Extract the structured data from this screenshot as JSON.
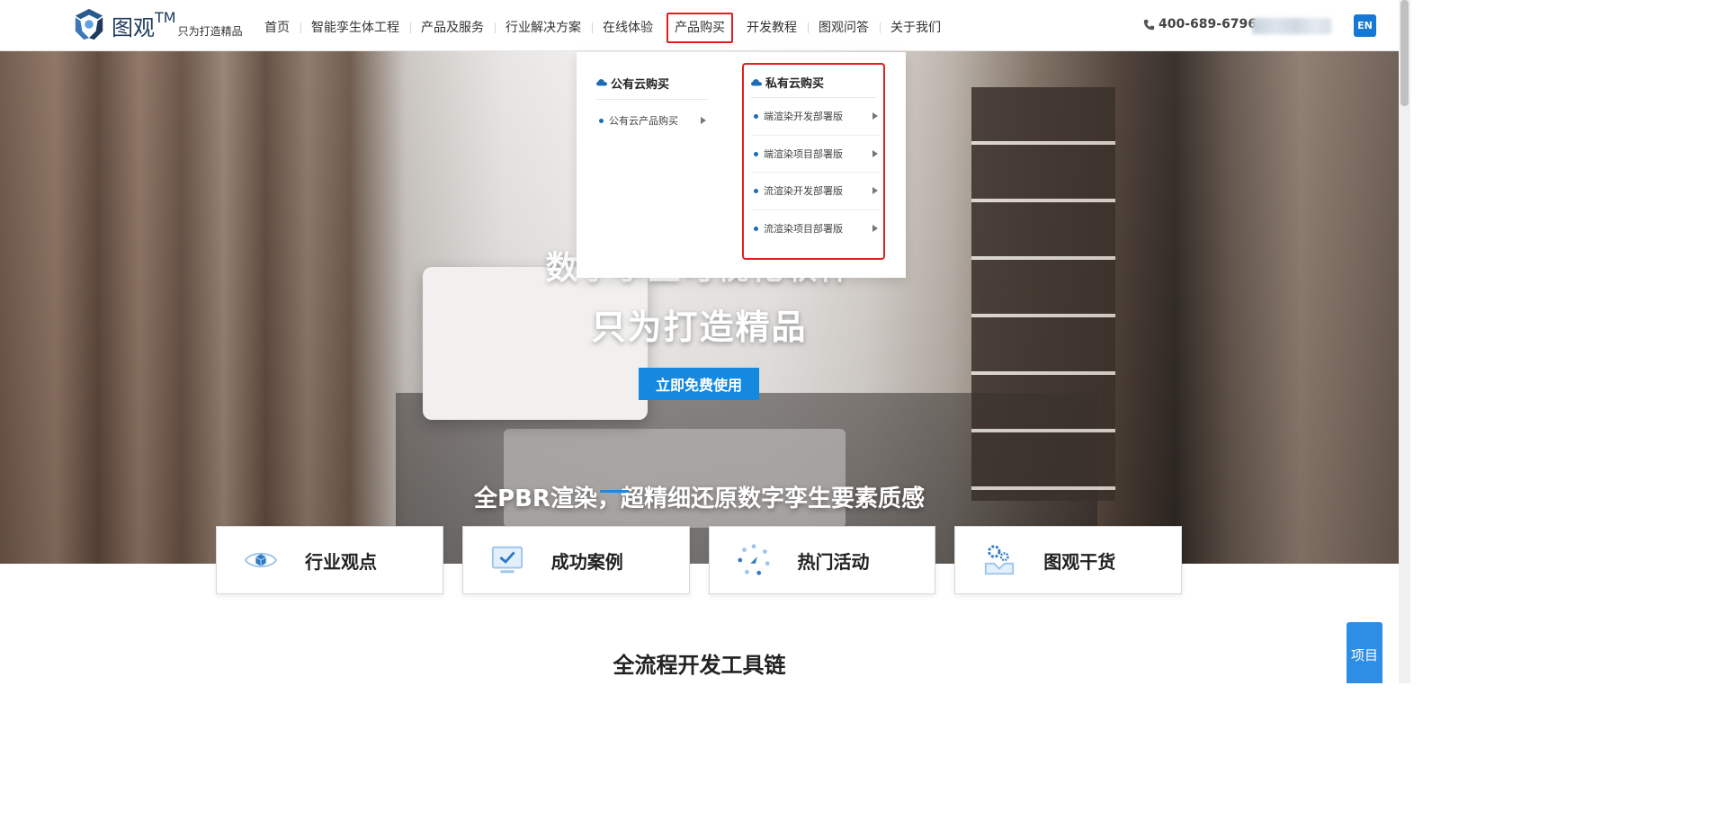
{
  "header": {
    "logo_name": "图观",
    "logo_tm": "TM",
    "logo_slogan": "只为打造精品",
    "nav": [
      {
        "label": "首页"
      },
      {
        "label": "智能孪生体工程"
      },
      {
        "label": "产品及服务"
      },
      {
        "label": "行业解决方案"
      },
      {
        "label": "在线体验"
      },
      {
        "label": "产品购买"
      },
      {
        "label": "开发教程"
      },
      {
        "label": "图观问答"
      },
      {
        "label": "关于我们"
      }
    ],
    "phone": "400-689-6796",
    "lang": "EN"
  },
  "dropdown": {
    "public": {
      "title": "公有云购买",
      "items": [
        {
          "label": "公有云产品购买"
        }
      ]
    },
    "private": {
      "title": "私有云购买",
      "items": [
        {
          "label": "端渲染开发部署版"
        },
        {
          "label": "端渲染项目部署版"
        },
        {
          "label": "流渲染开发部署版"
        },
        {
          "label": "流渲染项目部署版"
        }
      ]
    }
  },
  "hero": {
    "title_line1": "数字孪生可视化软件",
    "title_line2": "只为打造精品",
    "cta": "立即免费使用",
    "subtitle": "全PBR渲染，超精细还原数字孪生要素质感"
  },
  "cards": [
    {
      "label": "行业观点",
      "icon": "eye-cube-icon"
    },
    {
      "label": "成功案例",
      "icon": "monitor-check-icon"
    },
    {
      "label": "热门活动",
      "icon": "dots-ring-icon"
    },
    {
      "label": "图观干货",
      "icon": "gears-tray-icon"
    }
  ],
  "section_title": "全流程开发工具链",
  "side_button": "项目",
  "colors": {
    "accent": "#1588e0",
    "highlight": "#e02020",
    "brand_dark": "#1e3a5c"
  }
}
